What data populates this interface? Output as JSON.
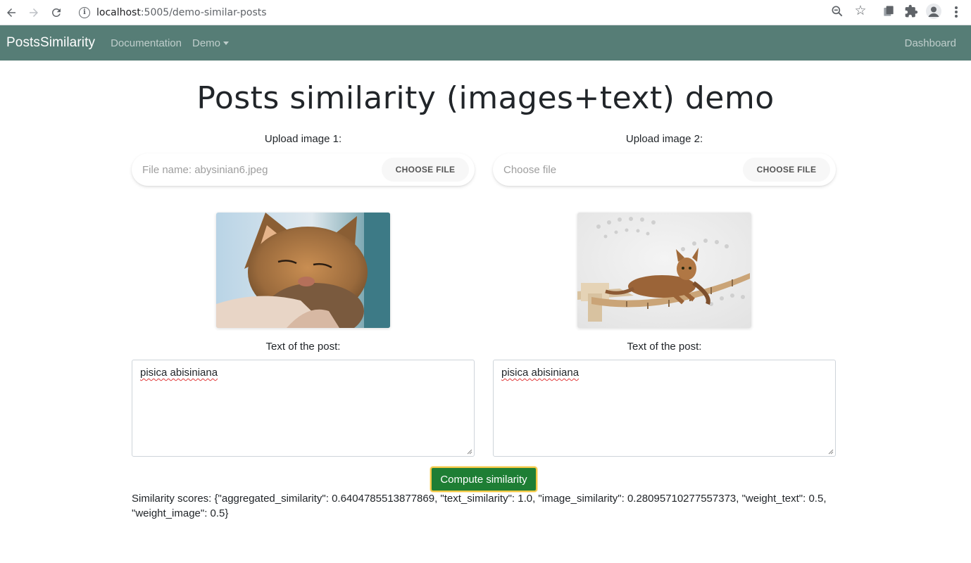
{
  "browser": {
    "url_host": "localhost",
    "url_path": ":5005/demo-similar-posts"
  },
  "navbar": {
    "brand": "PostsSimilarity",
    "links": [
      "Documentation",
      "Demo"
    ],
    "right_link": "Dashboard",
    "background_color": "#567d76"
  },
  "main": {
    "title": "Posts similarity (images+text) demo",
    "columns": [
      {
        "upload_label": "Upload image 1:",
        "file_text": "File name: abysinian6.jpeg",
        "choose_button": "CHOOSE FILE",
        "image_alt": "Abyssinian cat with eyes closed being petted",
        "text_label": "Text of the post:",
        "post_text": "pisica abisiniana"
      },
      {
        "upload_label": "Upload image 2:",
        "file_text": "Choose file",
        "choose_button": "CHOOSE FILE",
        "image_alt": "Abyssinian cat lying on a wall-mounted cat bridge",
        "text_label": "Text of the post:",
        "post_text": "pisica abisiniana"
      }
    ],
    "compute_button": "Compute similarity",
    "scores_text": "Similarity scores: {\"aggregated_similarity\": 0.6404785513877869, \"text_similarity\": 1.0, \"image_similarity\": 0.28095710277557373, \"weight_text\": 0.5, \"weight_image\": 0.5}"
  },
  "colors": {
    "accent_button": "#1e7e34",
    "button_focus_ring": "#f2c744"
  }
}
